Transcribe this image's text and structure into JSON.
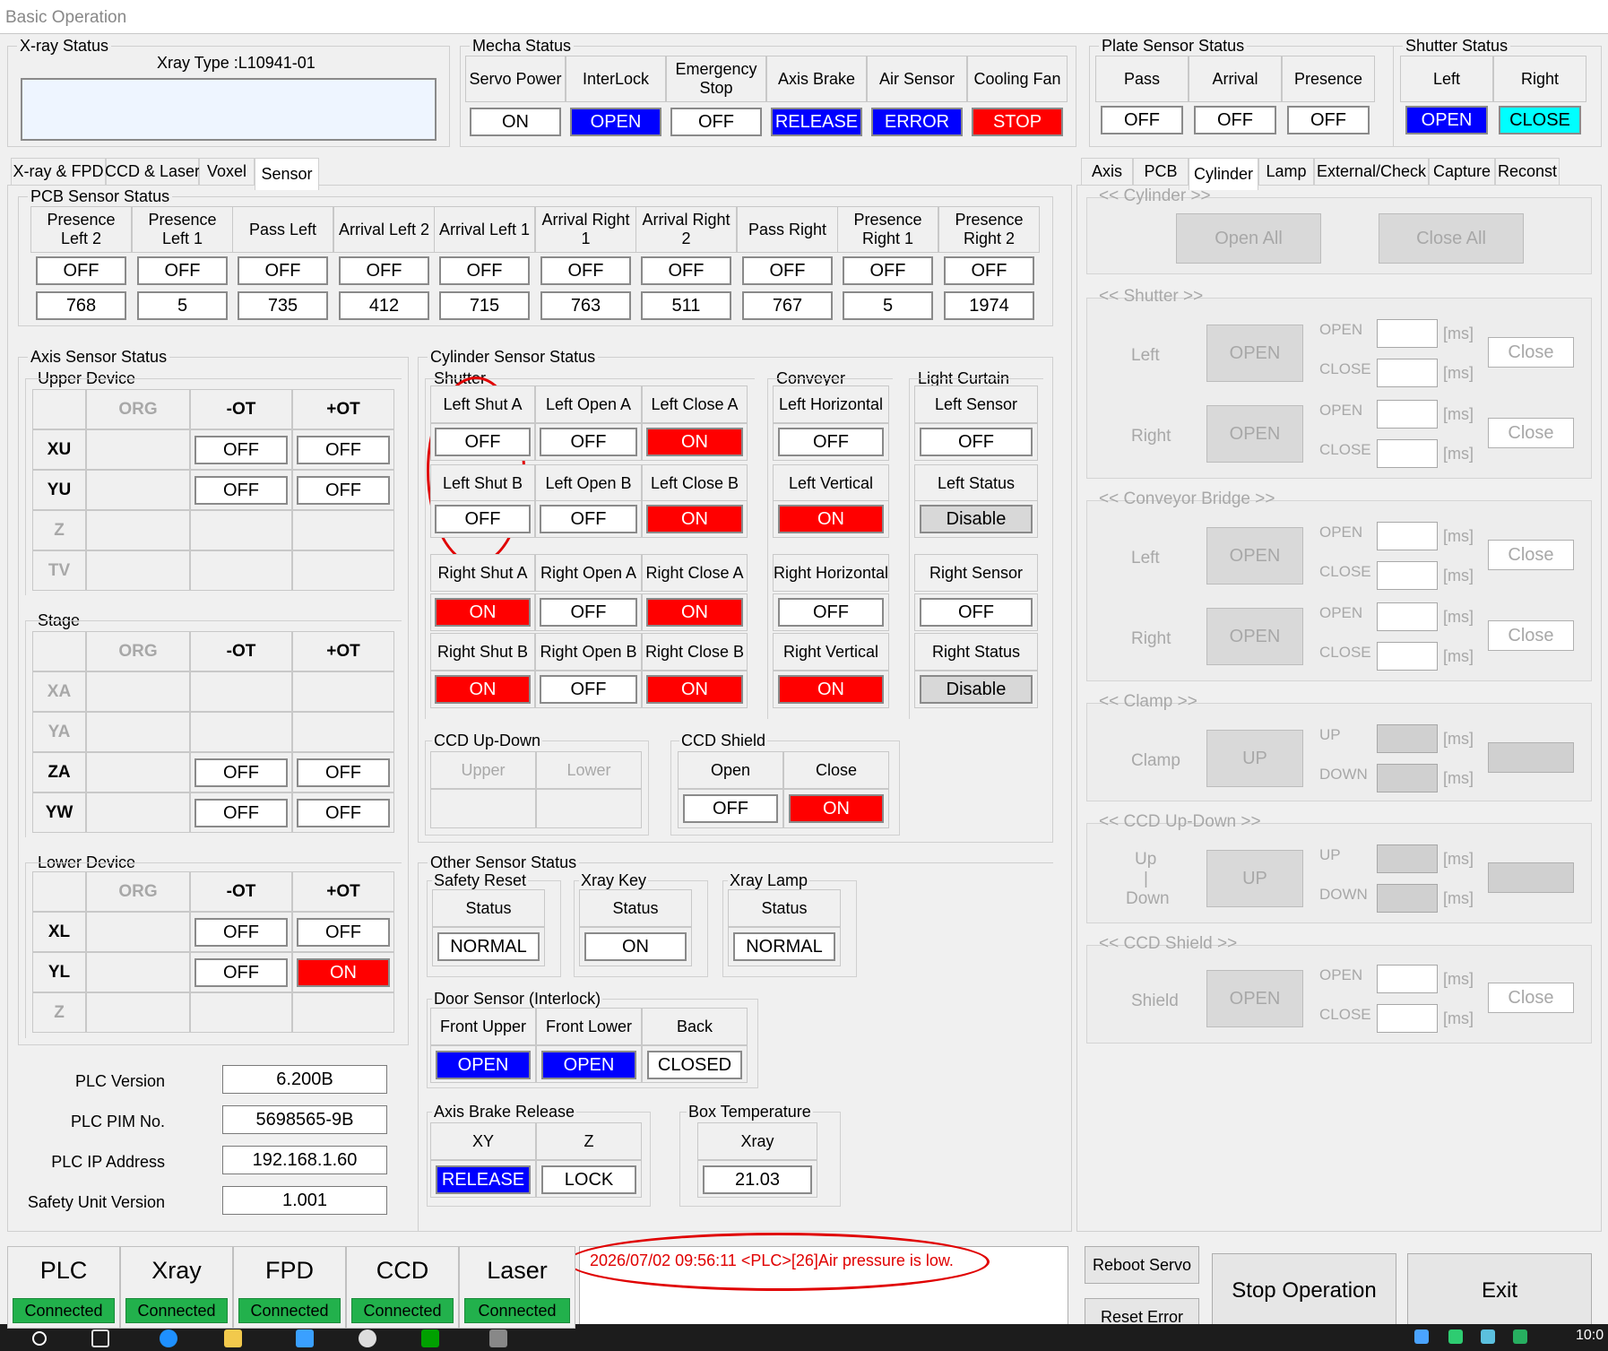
{
  "window": {
    "title": "Basic Operation"
  },
  "xray": {
    "label": "X-ray Status",
    "type": "Xray Type :L10941-01"
  },
  "mecha": {
    "label": "Mecha Status",
    "headers": [
      "Servo Power",
      "InterLock",
      "Emergency Stop",
      "Axis Brake",
      "Air Sensor",
      "Cooling Fan"
    ],
    "values": [
      "ON",
      "OPEN",
      "OFF",
      "RELEASE",
      "ERROR",
      "STOP"
    ]
  },
  "plate": {
    "label": "Plate Sensor Status",
    "headers": [
      "Pass",
      "Arrival",
      "Presence"
    ],
    "values": [
      "OFF",
      "OFF",
      "OFF"
    ]
  },
  "shutter_status": {
    "label": "Shutter Status",
    "headers": [
      "Left",
      "Right"
    ],
    "values": [
      "OPEN",
      "CLOSE"
    ]
  },
  "left_tabs": [
    "X-ray & FPD",
    "CCD & Laser",
    "Voxel",
    "Sensor"
  ],
  "right_tabs": [
    "Axis",
    "PCB",
    "Cylinder",
    "Lamp",
    "External/Check",
    "Capture",
    "Reconst"
  ],
  "pcb": {
    "label": "PCB Sensor Status",
    "headers": [
      "Presence Left 2",
      "Presence Left 1",
      "Pass Left",
      "Arrival Left 2",
      "Arrival Left 1",
      "Arrival Right 1",
      "Arrival Right 2",
      "Pass Right",
      "Presence Right 1",
      "Presence Right 2"
    ],
    "status": [
      "OFF",
      "OFF",
      "OFF",
      "OFF",
      "OFF",
      "OFF",
      "OFF",
      "OFF",
      "OFF",
      "OFF"
    ],
    "counts": [
      "768",
      "5",
      "735",
      "412",
      "715",
      "763",
      "511",
      "767",
      "5",
      "1974"
    ]
  },
  "axis": {
    "label": "Axis Sensor Status",
    "cols": [
      "ORG",
      "-OT",
      "+OT"
    ],
    "upper": {
      "label": "Upper Device",
      "rows": [
        {
          "name": "XU",
          "m": "OFF",
          "p": "OFF"
        },
        {
          "name": "YU",
          "m": "OFF",
          "p": "OFF"
        },
        {
          "name": "Z"
        },
        {
          "name": "TV"
        }
      ]
    },
    "stage": {
      "label": "Stage",
      "rows": [
        {
          "name": "XA"
        },
        {
          "name": "YA"
        },
        {
          "name": "ZA",
          "m": "OFF",
          "p": "OFF"
        },
        {
          "name": "YW",
          "m": "OFF",
          "p": "OFF"
        }
      ]
    },
    "lower": {
      "label": "Lower Device",
      "rows": [
        {
          "name": "XL",
          "m": "OFF",
          "p": "OFF"
        },
        {
          "name": "YL",
          "m": "OFF",
          "p": "ON"
        },
        {
          "name": "Z"
        }
      ]
    }
  },
  "plc": {
    "labels": [
      "PLC Version",
      "PLC PIM No.",
      "PLC IP Address",
      "Safety Unit Version"
    ],
    "values": [
      "6.200B",
      "5698565-9B",
      "192.168.1.60",
      "1.001"
    ]
  },
  "cyl": {
    "label": "Cylinder Sensor Status",
    "shutter_label": "Shutter",
    "conveyer_label": "Conveyer",
    "light_label": "Light Curtain",
    "shutter": [
      [
        "Left Shut A",
        "Left Open A",
        "Left Close A"
      ],
      [
        "OFF",
        "OFF",
        "ON"
      ],
      [
        "Left Shut B",
        "Left Open B",
        "Left Close B"
      ],
      [
        "OFF",
        "OFF",
        "ON"
      ],
      [
        "Right Shut A",
        "Right Open A",
        "Right Close A"
      ],
      [
        "ON",
        "OFF",
        "ON"
      ],
      [
        "Right Shut B",
        "Right Open B",
        "Right Close B"
      ],
      [
        "ON",
        "OFF",
        "ON"
      ]
    ],
    "conveyer": [
      "Left Horizontal",
      "OFF",
      "Left Vertical",
      "ON",
      "Right Horizontal",
      "OFF",
      "Right Vertical",
      "ON"
    ],
    "light": [
      "Left Sensor",
      "OFF",
      "Left Status",
      "Disable",
      "Right Sensor",
      "OFF",
      "Right Status",
      "Disable"
    ]
  },
  "ccd_updown": {
    "label": "CCD Up-Down",
    "headers": [
      "Upper",
      "Lower"
    ]
  },
  "ccd_shield": {
    "label": "CCD Shield",
    "headers": [
      "Open",
      "Close"
    ],
    "values": [
      "OFF",
      "ON"
    ]
  },
  "other": {
    "label": "Other Sensor Status",
    "safety": {
      "label": "Safety Reset",
      "header": "Status",
      "value": "NORMAL"
    },
    "xraykey": {
      "label": "Xray Key",
      "header": "Status",
      "value": "ON"
    },
    "xraylamp": {
      "label": "Xray Lamp",
      "header": "Status",
      "value": "NORMAL"
    }
  },
  "door": {
    "label": "Door Sensor (Interlock)",
    "headers": [
      "Front Upper",
      "Front Lower",
      "Back"
    ],
    "values": [
      "OPEN",
      "OPEN",
      "CLOSED"
    ]
  },
  "brake": {
    "label": "Axis Brake Release",
    "headers": [
      "XY",
      "Z"
    ],
    "values": [
      "RELEASE",
      "LOCK"
    ]
  },
  "boxtemp": {
    "label": "Box Temperature",
    "header": "Xray",
    "value": "21.03"
  },
  "right_panel": {
    "cylinder": {
      "label": "<< Cylinder >>",
      "open_all": "Open All",
      "close_all": "Close All"
    },
    "shutter": {
      "label": "<< Shutter >>",
      "left": "Left",
      "right": "Right"
    },
    "conveyor": {
      "label": "<< Conveyor Bridge >>",
      "left": "Left",
      "right": "Right"
    },
    "clamp": {
      "label": "<< Clamp >>",
      "name": "Clamp"
    },
    "ccdud": {
      "label": "<< CCD Up-Down >>",
      "up": "Up",
      "sep": "|",
      "down": "Down"
    },
    "ccdsh": {
      "label": "<< CCD Shield >>",
      "name": "Shield"
    },
    "open": "OPEN",
    "close": "CLOSE",
    "up": "UP",
    "down": "DOWN",
    "ms": "[ms]",
    "close_btn": "Close"
  },
  "status_bar": [
    {
      "name": "PLC",
      "value": "Connected"
    },
    {
      "name": "Xray",
      "value": "Connected"
    },
    {
      "name": "FPD",
      "value": "Connected"
    },
    {
      "name": "CCD",
      "value": "Connected"
    },
    {
      "name": "Laser",
      "value": "Connected"
    }
  ],
  "log": {
    "message": "2026/07/02 09:56:11 <PLC>[26]Air pressure is low."
  },
  "buttons": {
    "reboot": "Reboot Servo",
    "reset": "Reset Error",
    "stop": "Stop Operation",
    "exit": "Exit"
  },
  "taskbar": {
    "clock": "10:0"
  },
  "colors": {
    "on": "#ff0000",
    "off": "#ffffff",
    "blue": "#0000ff",
    "cyan": "#00ffff",
    "connected": "#22b14c",
    "alert": "#e00000"
  }
}
